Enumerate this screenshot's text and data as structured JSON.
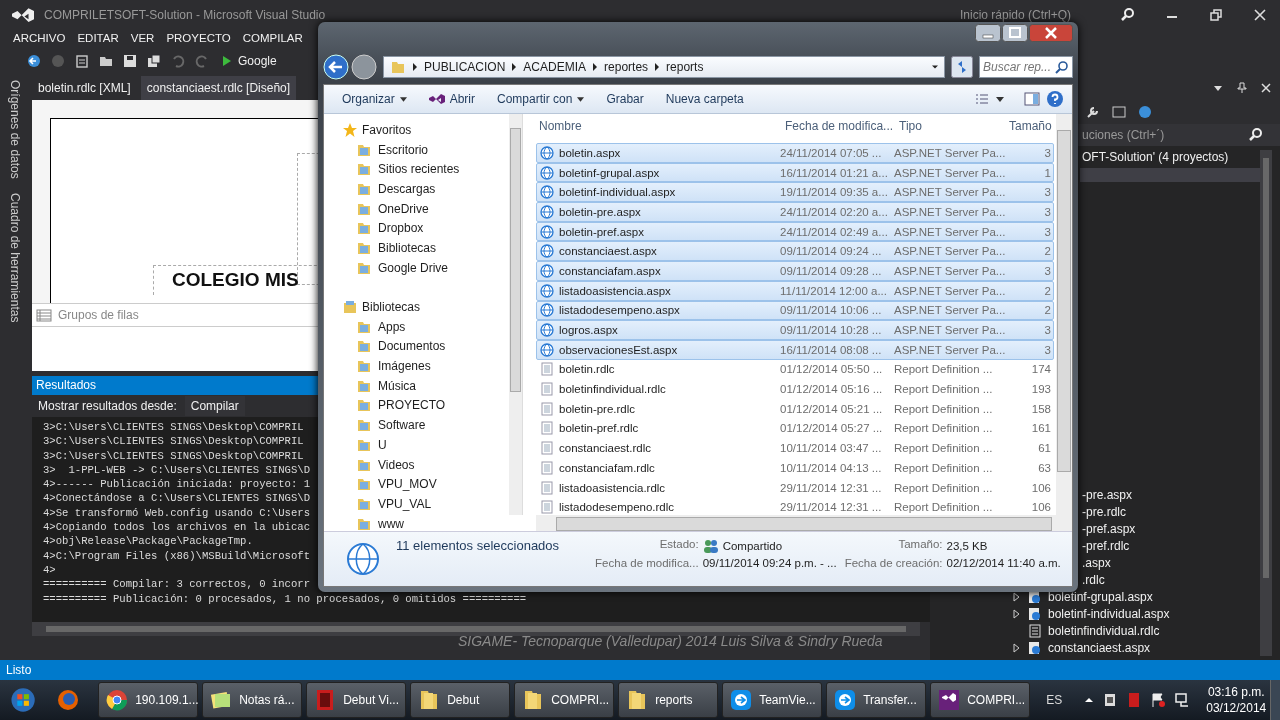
{
  "vs": {
    "title": "COMPRILETSOFT-Solution - Microsoft Visual Studio",
    "quick_launch": "Inicio rápido (Ctrl+Q)",
    "menu": [
      "ARCHIVO",
      "EDITAR",
      "VER",
      "PROYECTO",
      "COMPILAR"
    ],
    "run_target": "Google",
    "side_tabs": [
      "Orígenes de datos",
      "Cuadro de herramientas"
    ],
    "doc_tabs": [
      {
        "label": "boletin.rdlc [XML]",
        "selected": false
      },
      {
        "label": "constanciaest.rdlc [Diseño]",
        "selected": true
      }
    ],
    "designer_text": "COLEGIO MIS",
    "row_groups": "Grupos de filas",
    "output": {
      "title": "Resultados",
      "show_from_label": "Mostrar resultados desde:",
      "show_from": "Compilar",
      "lines": [
        "3>C:\\Users\\CLIENTES SINGS\\Desktop\\COMPRIL",
        "3>C:\\Users\\CLIENTES SINGS\\Desktop\\COMPRIL",
        "3>C:\\Users\\CLIENTES SINGS\\Desktop\\COMPRIL",
        "3>  1-PPL-WEB -> C:\\Users\\CLIENTES SINGS\\D",
        "4>------ Publicación iniciada: proyecto: 1",
        "4>Conectándose a C:\\Users\\CLIENTES SINGS\\D",
        "4>Se transformó Web.config usando C:\\Users",
        "4>Copiando todos los archivos en la ubicac",
        "4>obj\\Release\\Package\\PackageTmp.",
        "4>C:\\Program Files (x86)\\MSBuild\\Microsoft",
        "4>",
        "========== Compilar: 3 correctos, 0 incorr",
        "========== Publicación: 0 procesados, 1 no procesados, 0 omitidos =========="
      ]
    },
    "caption": "SIGAME- Tecnoparque (Valledupar) 2014 Luis Silva & Sindry Rueda",
    "solution": {
      "search": "uciones (Ctrl+´)",
      "root": "OFT-Solution'  (4 proyectos)",
      "items": [
        {
          "label": "-pre.aspx",
          "kind": "cut"
        },
        {
          "label": "-pre.rdlc",
          "kind": "cut"
        },
        {
          "label": "-pref.aspx",
          "kind": "cut"
        },
        {
          "label": "-pref.rdlc",
          "kind": "cut"
        },
        {
          "label": ".aspx",
          "kind": "cut"
        },
        {
          "label": ".rdlc",
          "kind": "cut"
        },
        {
          "label": "boletinf-grupal.aspx",
          "kind": "aspx"
        },
        {
          "label": "boletinf-individual.aspx",
          "kind": "aspx"
        },
        {
          "label": "boletinfindividual.rdlc",
          "kind": "rdlc"
        },
        {
          "label": "constanciaest.aspx",
          "kind": "aspx"
        }
      ]
    },
    "status": "Listo"
  },
  "explorer": {
    "path": [
      "PUBLICACION",
      "ACADEMIA",
      "reportes",
      "reports"
    ],
    "search": {
      "placeholder": "Buscar rep..."
    },
    "commands": [
      {
        "label": "Organizar",
        "dropdown": true
      },
      {
        "label": "Abrir",
        "dropdown": false
      },
      {
        "label": "Compartir con",
        "dropdown": true
      },
      {
        "label": "Grabar",
        "dropdown": false
      },
      {
        "label": "Nueva carpeta",
        "dropdown": false
      }
    ],
    "nav": [
      {
        "label": "Favoritos",
        "children": [
          "Escritorio",
          "Sitios recientes",
          "Descargas",
          "OneDrive",
          "Dropbox",
          "Bibliotecas",
          "Google Drive"
        ]
      },
      {
        "label": "Bibliotecas",
        "children": [
          "Apps",
          "Documentos",
          "Imágenes",
          "Música",
          "PROYECTO",
          "Software",
          "U",
          "Videos",
          "VPU_MOV",
          "VPU_VAL",
          "www"
        ]
      }
    ],
    "columns": [
      "Nombre",
      "Fecha de modifica...",
      "Tipo",
      "Tamaño"
    ],
    "files": [
      {
        "name": "boletin.aspx",
        "date": "24/11/2014 07:05 ...",
        "type": "ASP.NET Server Pa...",
        "size": "3",
        "kind": "aspx",
        "selected": true
      },
      {
        "name": "boletinf-grupal.aspx",
        "date": "16/11/2014 01:21 a...",
        "type": "ASP.NET Server Pa...",
        "size": "1",
        "kind": "aspx",
        "selected": true
      },
      {
        "name": "boletinf-individual.aspx",
        "date": "19/11/2014 09:35 a...",
        "type": "ASP.NET Server Pa...",
        "size": "3",
        "kind": "aspx",
        "selected": true
      },
      {
        "name": "boletin-pre.aspx",
        "date": "24/11/2014 02:20 a...",
        "type": "ASP.NET Server Pa...",
        "size": "3",
        "kind": "aspx",
        "selected": true
      },
      {
        "name": "boletin-pref.aspx",
        "date": "24/11/2014 02:49 a...",
        "type": "ASP.NET Server Pa...",
        "size": "3",
        "kind": "aspx",
        "selected": true
      },
      {
        "name": "constanciaest.aspx",
        "date": "09/11/2014 09:24 ...",
        "type": "ASP.NET Server Pa...",
        "size": "2",
        "kind": "aspx",
        "selected": true
      },
      {
        "name": "constanciafam.aspx",
        "date": "09/11/2014 09:28 ...",
        "type": "ASP.NET Server Pa...",
        "size": "3",
        "kind": "aspx",
        "selected": true
      },
      {
        "name": "listadoasistencia.aspx",
        "date": "11/11/2014 12:00 a...",
        "type": "ASP.NET Server Pa...",
        "size": "2",
        "kind": "aspx",
        "selected": true
      },
      {
        "name": "listadodesempeno.aspx",
        "date": "09/11/2014 10:06 ...",
        "type": "ASP.NET Server Pa...",
        "size": "2",
        "kind": "aspx",
        "selected": true
      },
      {
        "name": "logros.aspx",
        "date": "09/11/2014 10:28 ...",
        "type": "ASP.NET Server Pa...",
        "size": "3",
        "kind": "aspx",
        "selected": true
      },
      {
        "name": "observacionesEst.aspx",
        "date": "16/11/2014 08:08 ...",
        "type": "ASP.NET Server Pa...",
        "size": "3",
        "kind": "aspx",
        "selected": true
      },
      {
        "name": "boletin.rdlc",
        "date": "01/12/2014 05:50 ...",
        "type": "Report Definition ...",
        "size": "174",
        "kind": "rdlc",
        "selected": false
      },
      {
        "name": "boletinfindividual.rdlc",
        "date": "01/12/2014 05:16 ...",
        "type": "Report Definition ...",
        "size": "193",
        "kind": "rdlc",
        "selected": false
      },
      {
        "name": "boletin-pre.rdlc",
        "date": "01/12/2014 05:21 ...",
        "type": "Report Definition ...",
        "size": "158",
        "kind": "rdlc",
        "selected": false
      },
      {
        "name": "boletin-pref.rdlc",
        "date": "01/12/2014 05:27 ...",
        "type": "Report Definition ...",
        "size": "161",
        "kind": "rdlc",
        "selected": false
      },
      {
        "name": "constanciaest.rdlc",
        "date": "10/11/2014 03:47 ...",
        "type": "Report Definition ...",
        "size": "61",
        "kind": "rdlc",
        "selected": false
      },
      {
        "name": "constanciafam.rdlc",
        "date": "10/11/2014 04:13 ...",
        "type": "Report Definition ...",
        "size": "63",
        "kind": "rdlc",
        "selected": false
      },
      {
        "name": "listadoasistencia.rdlc",
        "date": "29/11/2014 12:31 ...",
        "type": "Report Definition ...",
        "size": "106",
        "kind": "rdlc",
        "selected": false
      },
      {
        "name": "listadodesempeno.rdlc",
        "date": "29/11/2014 12:31 ...",
        "type": "Report Definition ...",
        "size": "106",
        "kind": "rdlc",
        "selected": false
      }
    ],
    "details": {
      "summary": "11 elementos seleccionados",
      "fields": [
        {
          "label": "Estado:",
          "value": "Compartido"
        },
        {
          "label": "Tamaño:",
          "value": "23,5 KB"
        },
        {
          "label": "Fecha de modifica...",
          "value": "09/11/2014 09:24 p.m. - ..."
        },
        {
          "label": "Fecha de creación:",
          "value": "02/12/2014 11:40 a.m."
        }
      ]
    }
  },
  "taskbar": {
    "tasks": [
      {
        "label": "190.109.1...",
        "kind": "browser"
      },
      {
        "label": "Notas rá...",
        "kind": "notes"
      },
      {
        "label": "Debut Vi...",
        "kind": "video"
      },
      {
        "label": "Debut",
        "kind": "folder"
      },
      {
        "label": "COMPRI...",
        "kind": "folder"
      },
      {
        "label": "reports",
        "kind": "folder"
      },
      {
        "label": "TeamVie...",
        "kind": "remote"
      },
      {
        "label": "Transfer...",
        "kind": "remote"
      },
      {
        "label": "COMPRI...",
        "kind": "vs"
      }
    ],
    "language": "ES",
    "time": "03:16 p.m.",
    "date": "03/12/2014"
  }
}
